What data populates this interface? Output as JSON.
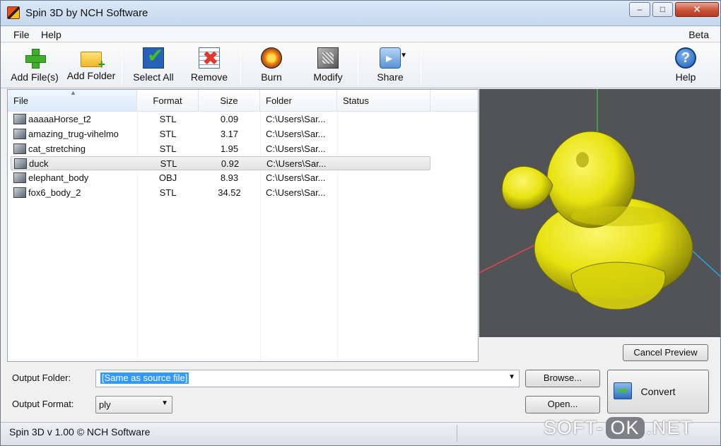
{
  "window": {
    "title": "Spin 3D by NCH Software",
    "controls": {
      "minimize": "–",
      "maximize": "□",
      "close": "✕"
    }
  },
  "menu": {
    "file": "File",
    "help": "Help",
    "beta": "Beta"
  },
  "toolbar": {
    "add_files": "Add File(s)",
    "add_folder": "Add Folder",
    "select_all": "Select All",
    "remove": "Remove",
    "burn": "Burn",
    "modify": "Modify",
    "share": "Share",
    "help": "Help",
    "share_caret": "▼",
    "help_glyph": "?"
  },
  "file_list": {
    "columns": [
      "File",
      "Format",
      "Size",
      "Folder",
      "Status"
    ],
    "sort_indicator": "▲",
    "rows": [
      {
        "file": "aaaaaHorse_t2",
        "format": "STL",
        "size": "0.09",
        "folder": "C:\\Users\\Sar...",
        "status": ""
      },
      {
        "file": "amazing_trug-vihelmo",
        "format": "STL",
        "size": "3.17",
        "folder": "C:\\Users\\Sar...",
        "status": ""
      },
      {
        "file": "cat_stretching",
        "format": "STL",
        "size": "1.95",
        "folder": "C:\\Users\\Sar...",
        "status": ""
      },
      {
        "file": "duck",
        "format": "STL",
        "size": "0.92",
        "folder": "C:\\Users\\Sar...",
        "status": "",
        "selected": true
      },
      {
        "file": "elephant_body",
        "format": "OBJ",
        "size": "8.93",
        "folder": "C:\\Users\\Sar...",
        "status": ""
      },
      {
        "file": "fox6_body_2",
        "format": "STL",
        "size": "34.52",
        "folder": "C:\\Users\\Sar...",
        "status": ""
      }
    ]
  },
  "preview": {
    "background": "#515357",
    "model_color": "#e7e20f",
    "axis_colors": {
      "x": "#d94a4a",
      "y": "#3cb34a",
      "z": "#2aa3e0"
    }
  },
  "buttons": {
    "cancel_preview": "Cancel Preview",
    "browse": "Browse...",
    "open": "Open...",
    "convert": "Convert"
  },
  "output": {
    "folder_label": "Output Folder:",
    "folder_value": "[Same as source file]",
    "format_label": "Output Format:",
    "format_value": "ply",
    "dropdown_arrow": "▼"
  },
  "status": {
    "text": "Spin 3D v 1.00 © NCH Software"
  },
  "watermark": {
    "left": "SOFT-",
    "pill": "OK",
    "right": ".NET"
  }
}
